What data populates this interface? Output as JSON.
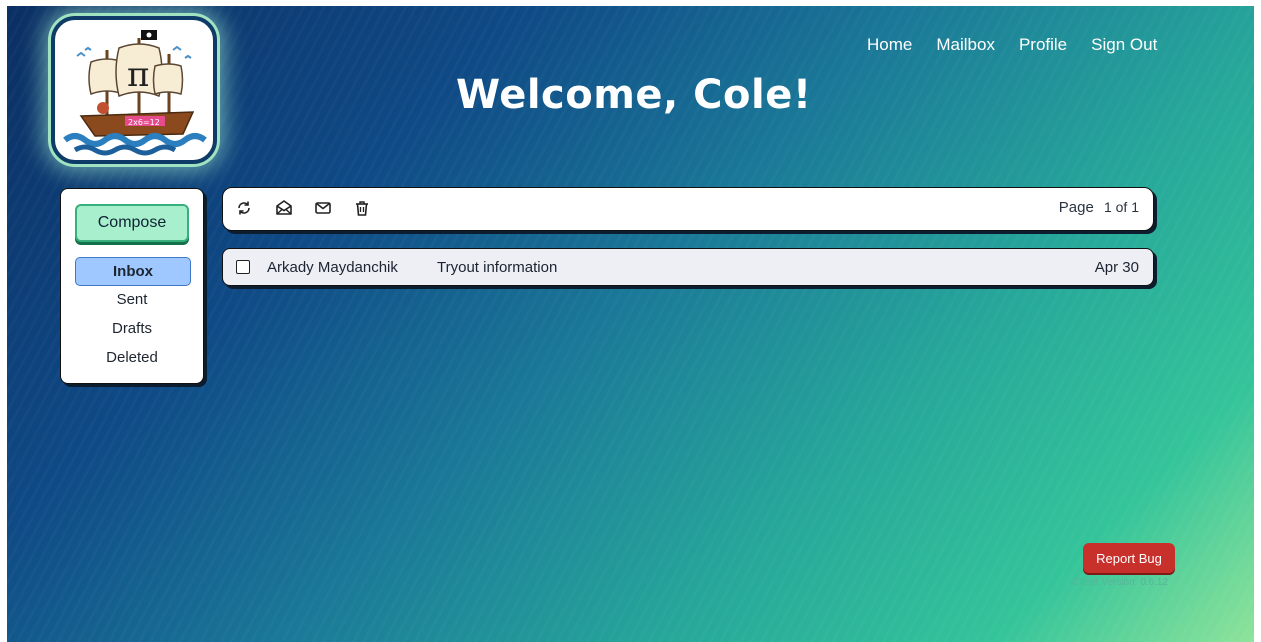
{
  "header": {
    "welcome_text": "Welcome, Cole!",
    "logo_icon": "pirate-ship-pi-logo"
  },
  "nav": {
    "items": [
      {
        "label": "Home"
      },
      {
        "label": "Mailbox"
      },
      {
        "label": "Profile"
      },
      {
        "label": "Sign Out"
      }
    ]
  },
  "sidebar": {
    "compose_label": "Compose",
    "folders": [
      {
        "label": "Inbox",
        "active": true
      },
      {
        "label": "Sent",
        "active": false
      },
      {
        "label": "Drafts",
        "active": false
      },
      {
        "label": "Deleted",
        "active": false
      }
    ]
  },
  "toolbar": {
    "icons": [
      "refresh-icon",
      "mark-read-icon",
      "mark-unread-icon",
      "trash-icon"
    ],
    "page_label": "Page",
    "page_value": "1 of 1"
  },
  "messages": [
    {
      "sender": "Arkady Maydanchik",
      "subject": "Tryout information",
      "date": "Apr 30",
      "checked": false
    }
  ],
  "footer": {
    "report_bug_label": "Report Bug",
    "version_text": "Client Version: 0.6.12"
  },
  "colors": {
    "compose_bg": "#a7efcd",
    "active_folder_bg": "#9ec8ff",
    "report_bug_bg": "#c8302b",
    "bg_start": "#0b2f63",
    "bg_end": "#8ee39a"
  }
}
